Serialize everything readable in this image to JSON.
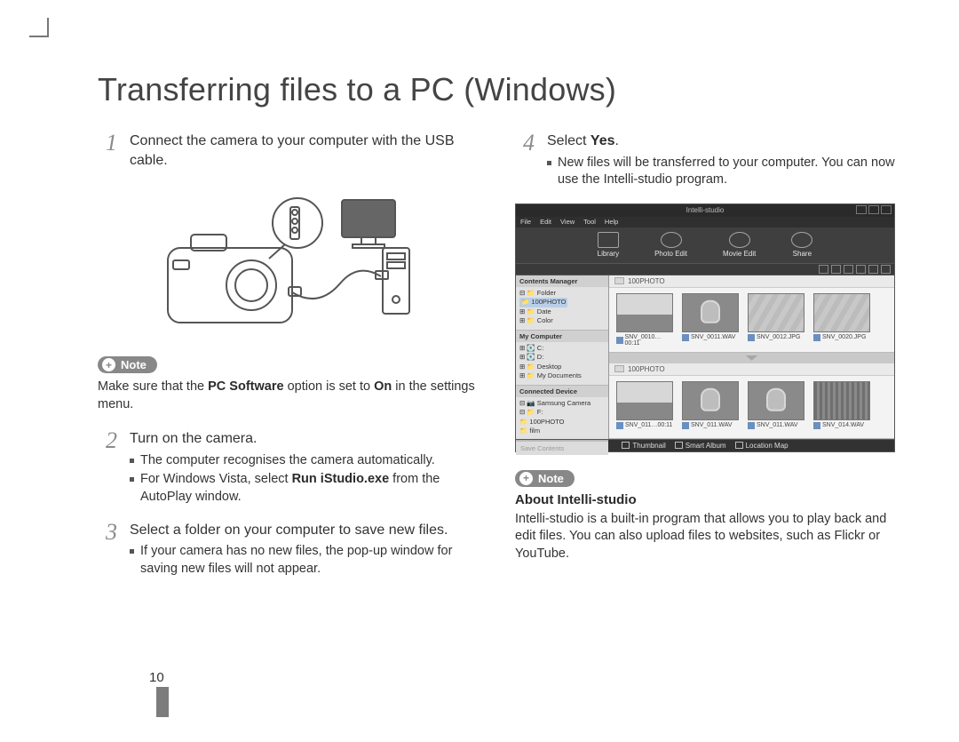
{
  "title": "Transferring files to a PC (Windows)",
  "page_number": "10",
  "left": {
    "step1": {
      "text": "Connect the camera to your computer with the USB cable."
    },
    "note1": {
      "label": "Note",
      "text_pre": "Make sure that the ",
      "bold1": "PC Software",
      "mid": " option is set to ",
      "bold2": "On",
      "post": " in the settings menu."
    },
    "step2": {
      "text": "Turn on the camera.",
      "b1": "The computer recognises the camera automatically.",
      "b2_pre": "For Windows Vista, select ",
      "b2_bold": "Run iStudio.exe",
      "b2_post": " from the AutoPlay window."
    },
    "step3": {
      "text": "Select a folder on your computer to save new files.",
      "b1": "If your camera has no new files, the pop-up window for saving new files will not appear."
    }
  },
  "right": {
    "step4": {
      "pre": "Select ",
      "bold": "Yes",
      "post": ".",
      "b1": "New files will be transferred to your computer. You can now use the Intelli-studio program."
    },
    "note2": {
      "label": "Note",
      "heading": "About Intelli-studio",
      "text": "Intelli-studio is a built-in program that allows you to play back and edit files. You can also upload files to websites, such as Flickr or YouTube."
    }
  },
  "app": {
    "title": "Intelli-studio",
    "menu": [
      "File",
      "Edit",
      "View",
      "Tool",
      "Help"
    ],
    "nav": [
      "Library",
      "Photo Edit",
      "Movie Edit",
      "Share"
    ],
    "side": {
      "h1": "Contents Manager",
      "tree1": [
        "⊟ 📁 Folder",
        "   📁 100PHOTO",
        "⊞ 📁 Date",
        "⊞ 📁 Color"
      ],
      "h2": "My Computer",
      "tree2": [
        "⊞ 💽 C:",
        "⊞ 💽 D:",
        "⊞ 📁 Desktop",
        "⊞ 📁 My Documents"
      ],
      "h3": "Connected Device",
      "tree3": [
        "⊟ 📷 Samsung Camera",
        "   ⊟ 📁 F:",
        "      📁 100PHOTO",
        "      📁 film"
      ],
      "foot": "Save Contents"
    },
    "pane1": {
      "folder": "100PHOTO",
      "caps": [
        "SNV_0010…00:11",
        "SNV_0011.WAV",
        "SNV_0012.JPG",
        "SNV_0020.JPG"
      ]
    },
    "pane2": {
      "folder": "100PHOTO",
      "caps": [
        "SNV_011…00:11",
        "SNV_011.WAV",
        "SNV_011.WAV",
        "SNV_014.WAV"
      ]
    },
    "status": [
      "Thumbnail",
      "Smart Album",
      "Location Map"
    ]
  }
}
